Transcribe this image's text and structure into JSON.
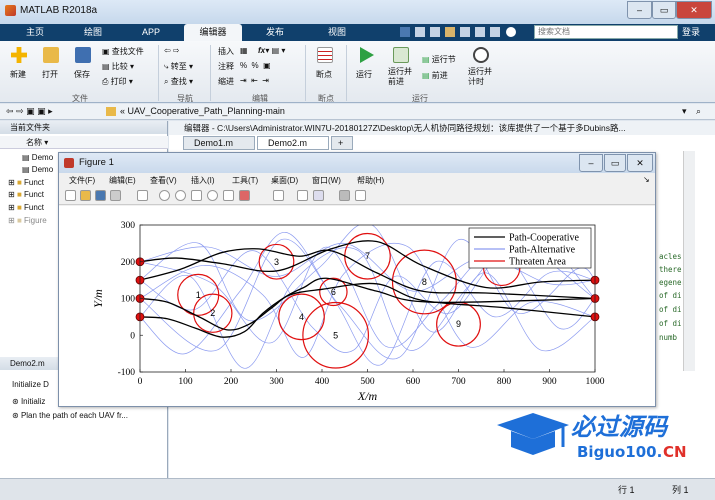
{
  "app": {
    "title": "MATLAB R2018a"
  },
  "tabs": [
    "主页",
    "绘图",
    "APP",
    "编辑器",
    "发布",
    "视图"
  ],
  "search": {
    "placeholder": "搜索文档"
  },
  "login": "登录",
  "ribbon": {
    "file": {
      "new": "新建",
      "open": "打开",
      "save": "保存",
      "find_files": "查找文件",
      "compare": "比较",
      "print": "打印",
      "group": "文件"
    },
    "nav": {
      "goto": "转至",
      "find": "查找",
      "group": "导航"
    },
    "edit": {
      "insert": "插入",
      "comment": "注释",
      "indent": "缩进",
      "fx": "fx",
      "group": "编辑"
    },
    "breakpoints": {
      "label": "断点",
      "group": "断点"
    },
    "run": {
      "run": "运行",
      "run_advance": "运行并\n前进",
      "run_section": "运行节",
      "advance": "前进",
      "run_time": "运行并\n计时",
      "group": "运行"
    }
  },
  "address": {
    "path": "« UAV_Cooperative_Path_Planning-main"
  },
  "current_folder": {
    "title": "当前文件夹",
    "name_col": "名称",
    "items": [
      "Demo",
      "Demo",
      "Funct",
      "Funct",
      "Funct",
      "Figure"
    ]
  },
  "details": {
    "file": "Demo2.m",
    "items": [
      "Initialize D",
      "Initializ",
      "Plan the path of each UAV fr..."
    ]
  },
  "editor": {
    "path": "编辑器 - C:\\Users\\Administrator.WIN7U-20180127Z\\Desktop\\无人机协同路径规划：该库提供了一个基于多Dubins路...",
    "tabs": [
      "Demo1.m",
      "Demo2.m",
      "+"
    ],
    "code_lines": [
      "acles",
      "there",
      "egener",
      "of di",
      "of di",
      "of di",
      "numb"
    ]
  },
  "status": {
    "row_label": "行",
    "row": "1",
    "col_label": "列",
    "col": "1"
  },
  "figure": {
    "title": "Figure 1",
    "menus": [
      "文件(F)",
      "编辑(E)",
      "查看(V)",
      "插入(I)",
      "工具(T)",
      "桌面(D)",
      "窗口(W)",
      "帮助(H)"
    ]
  },
  "chart_data": {
    "type": "line",
    "xlabel": "X/m",
    "ylabel": "Y/m",
    "xlim": [
      0,
      1000
    ],
    "ylim": [
      -100,
      300
    ],
    "xticks": [
      0,
      100,
      200,
      300,
      400,
      500,
      600,
      700,
      800,
      900,
      1000
    ],
    "yticks": [
      -100,
      0,
      100,
      200,
      300
    ],
    "legend": {
      "position": "top-right",
      "entries": [
        "Path-Cooperative",
        "Path-Alternative",
        "Threaten Area"
      ]
    },
    "colors": {
      "cooperative": "#000000",
      "alternative": "#8c9bf0",
      "threat": "#e01010",
      "uav": "#e01010"
    },
    "threats": [
      {
        "label": "1",
        "x": 128,
        "y": 110,
        "r": 45
      },
      {
        "label": "2",
        "x": 160,
        "y": 60,
        "r": 42
      },
      {
        "label": "3",
        "x": 300,
        "y": 200,
        "r": 38
      },
      {
        "label": "4",
        "x": 355,
        "y": 50,
        "r": 50
      },
      {
        "label": "5",
        "x": 430,
        "y": 0,
        "r": 72
      },
      {
        "label": "6",
        "x": 425,
        "y": 118,
        "r": 30
      },
      {
        "label": "7",
        "x": 500,
        "y": 215,
        "r": 50
      },
      {
        "label": "8",
        "x": 625,
        "y": 145,
        "r": 70
      },
      {
        "label": "9",
        "x": 700,
        "y": 30,
        "r": 48
      },
      {
        "label": "",
        "x": 795,
        "y": 185,
        "r": 40
      }
    ],
    "starts": [
      {
        "x": 0,
        "y": 200
      },
      {
        "x": 0,
        "y": 150
      },
      {
        "x": 0,
        "y": 100
      },
      {
        "x": 0,
        "y": 50
      }
    ],
    "goals": [
      {
        "x": 1000,
        "y": 150
      },
      {
        "x": 1000,
        "y": 100
      },
      {
        "x": 1000,
        "y": 50
      }
    ],
    "paths": [
      {
        "x": [
          0,
          80,
          180,
          300,
          420,
          520,
          620,
          760,
          880,
          1000
        ],
        "y": [
          200,
          210,
          195,
          175,
          235,
          255,
          190,
          130,
          145,
          150
        ]
      },
      {
        "x": [
          0,
          90,
          180,
          260,
          350,
          420,
          520,
          620,
          760,
          1000
        ],
        "y": [
          150,
          180,
          225,
          235,
          215,
          230,
          170,
          120,
          115,
          100
        ]
      },
      {
        "x": [
          0,
          60,
          130,
          190,
          240,
          290,
          330,
          400,
          520,
          620,
          800,
          1000
        ],
        "y": [
          100,
          90,
          50,
          15,
          30,
          75,
          110,
          125,
          140,
          95,
          75,
          50
        ]
      },
      {
        "x": [
          0,
          60,
          120,
          180,
          230,
          270,
          320,
          360,
          410,
          520,
          640,
          1000
        ],
        "y": [
          50,
          45,
          20,
          -5,
          10,
          60,
          105,
          130,
          155,
          120,
          90,
          100
        ]
      }
    ],
    "alt_paths": [
      {
        "x": [
          0,
          150,
          300,
          450,
          600,
          750,
          900,
          1000
        ],
        "y": [
          200,
          240,
          160,
          250,
          120,
          210,
          140,
          150
        ]
      },
      {
        "x": [
          0,
          120,
          250,
          380,
          470,
          560,
          680,
          820,
          1000
        ],
        "y": [
          150,
          70,
          230,
          20,
          -40,
          160,
          60,
          240,
          100
        ]
      },
      {
        "x": [
          0,
          140,
          270,
          360,
          450,
          590,
          720,
          860,
          1000
        ],
        "y": [
          100,
          190,
          110,
          -60,
          170,
          240,
          -30,
          90,
          50
        ]
      },
      {
        "x": [
          0,
          100,
          220,
          320,
          430,
          530,
          650,
          780,
          900,
          1000
        ],
        "y": [
          50,
          -50,
          120,
          280,
          90,
          -80,
          200,
          50,
          170,
          150
        ]
      },
      {
        "x": [
          0,
          160,
          290,
          410,
          540,
          660,
          790,
          920,
          1000
        ],
        "y": [
          200,
          140,
          -20,
          240,
          -30,
          90,
          230,
          20,
          100
        ]
      },
      {
        "x": [
          0,
          130,
          240,
          390,
          510,
          640,
          760,
          880,
          1000
        ],
        "y": [
          150,
          250,
          40,
          180,
          300,
          10,
          170,
          -40,
          50
        ]
      },
      {
        "x": [
          0,
          170,
          310,
          440,
          570,
          700,
          830,
          960,
          1000
        ],
        "y": [
          100,
          -40,
          260,
          80,
          -60,
          260,
          60,
          180,
          150
        ]
      },
      {
        "x": [
          0,
          110,
          230,
          340,
          480,
          590,
          720,
          850,
          1000
        ],
        "y": [
          50,
          160,
          -90,
          150,
          230,
          -40,
          130,
          290,
          100
        ]
      }
    ]
  }
}
